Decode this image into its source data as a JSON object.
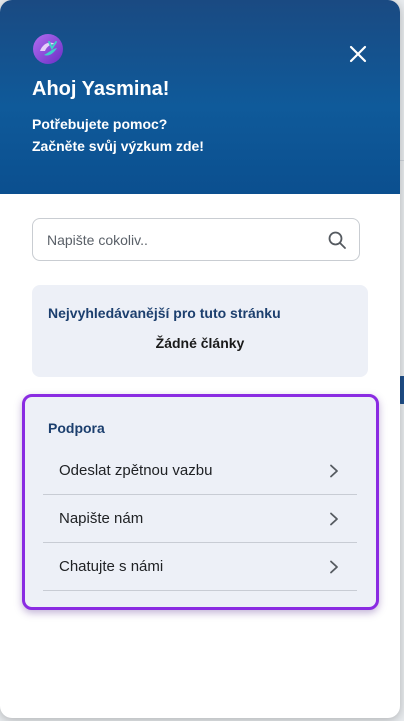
{
  "header": {
    "greeting": "Ahoj Yasmina!",
    "subtitle_line1": "Potřebujete pomoc?",
    "subtitle_line2": "Začněte svůj výzkum zde!"
  },
  "search": {
    "placeholder": "Napište cokoliv..",
    "value": ""
  },
  "top_searched": {
    "title": "Nejvyhledávanější pro tuto stránku",
    "empty_text": "Žádné články"
  },
  "support": {
    "title": "Podpora",
    "items": [
      {
        "label": "Odeslat zpětnou vazbu"
      },
      {
        "label": "Napište nám"
      },
      {
        "label": "Chatujte s námi"
      }
    ]
  },
  "colors": {
    "header_blue": "#0f5a9a",
    "highlight_purple": "#8a2be2",
    "heading_navy": "#1c3f6e"
  },
  "icons": {
    "logo": "brand-logo-icon",
    "close": "close-icon",
    "search": "search-icon",
    "chevron": "chevron-right-icon"
  }
}
